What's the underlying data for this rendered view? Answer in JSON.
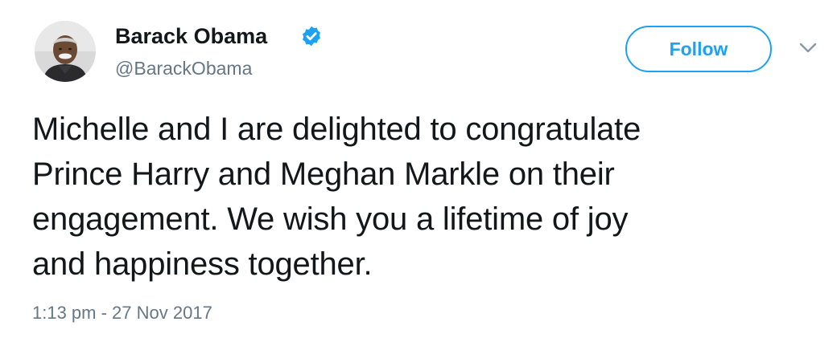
{
  "author": {
    "name": "Barack Obama",
    "handle": "@BarackObama",
    "verified": true,
    "avatar_icon": "profile-photo"
  },
  "actions": {
    "follow_label": "Follow",
    "more_icon": "chevron-down-icon"
  },
  "tweet": {
    "lines": [
      "Michelle and I are delighted to congratulate",
      "Prince Harry and Meghan Markle on their",
      "engagement. We wish you a lifetime of joy",
      "and happiness together."
    ],
    "timestamp": "1:13 pm - 27 Nov 2017"
  },
  "colors": {
    "accent": "#1da1f2",
    "text": "#14171a",
    "muted": "#657786"
  }
}
